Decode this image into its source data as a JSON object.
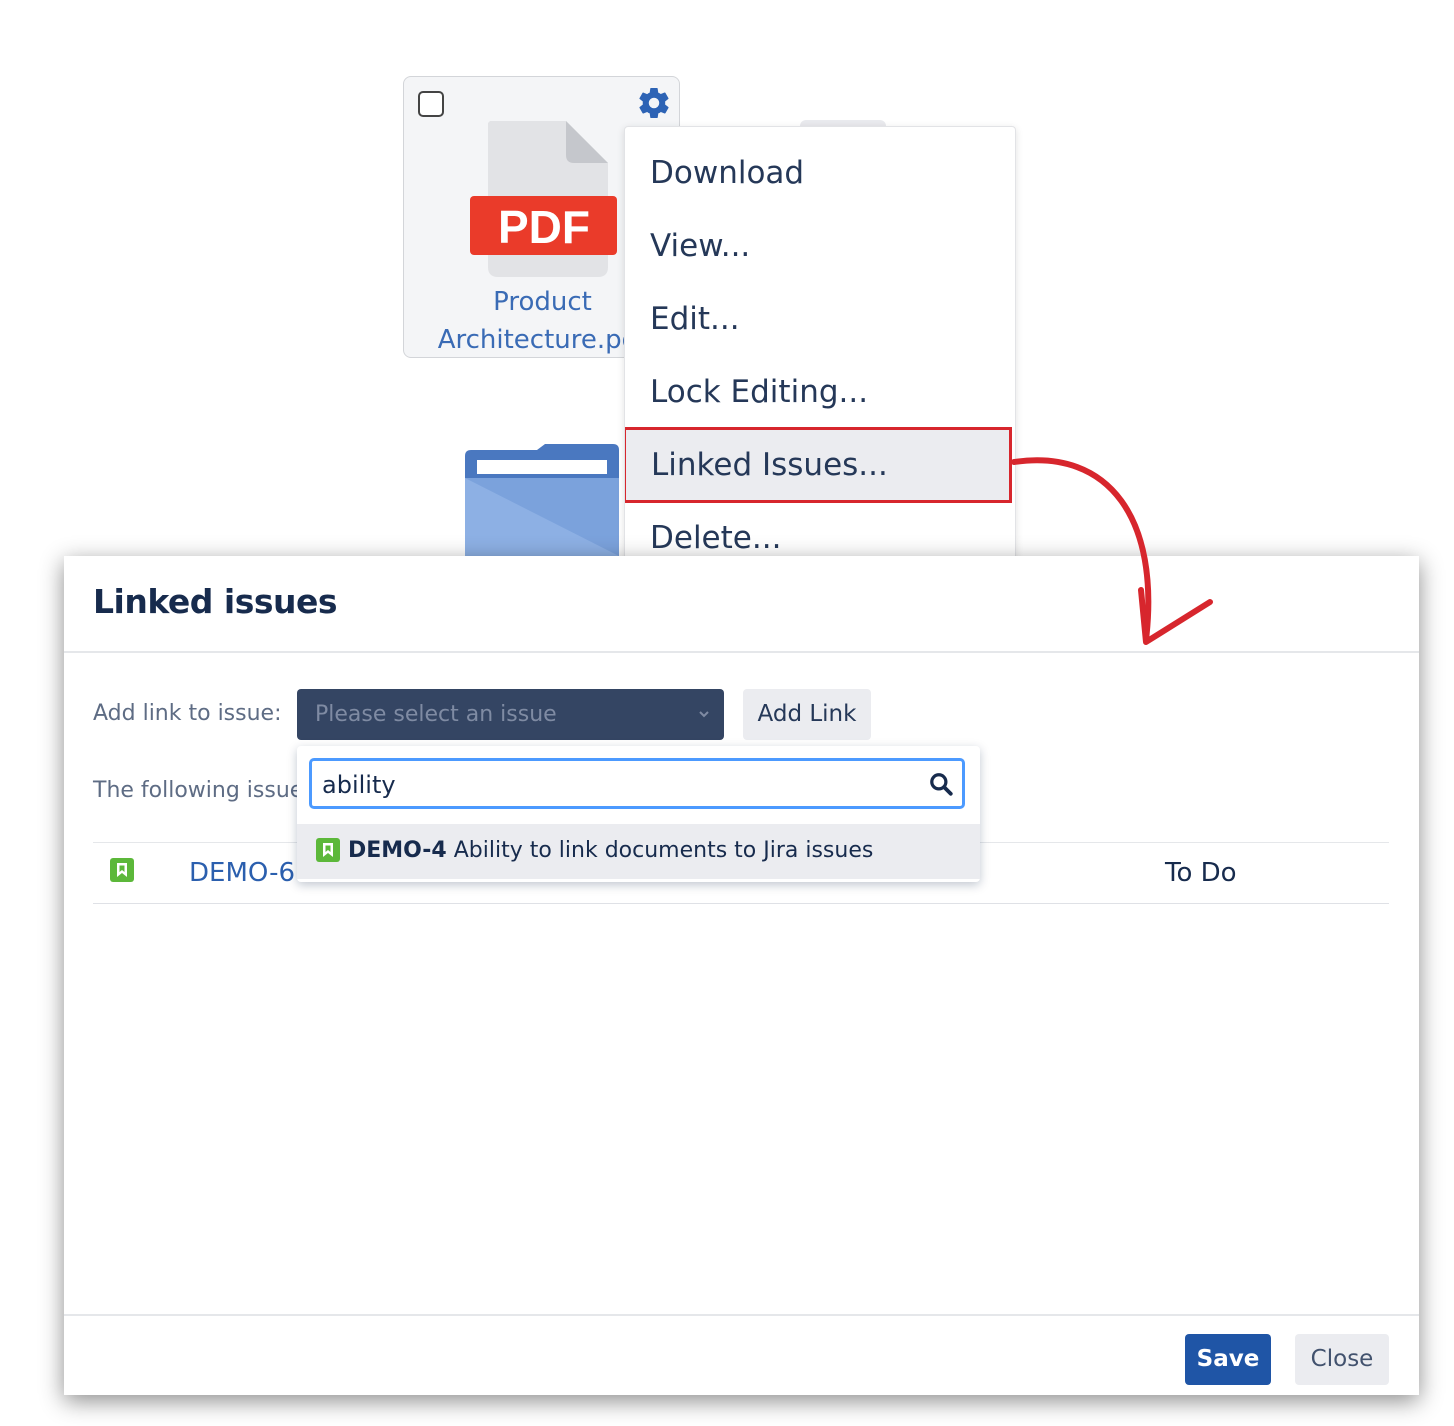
{
  "file_card": {
    "name_line1": "Product",
    "name_line2": "Architecture.pdf",
    "type_label": "PDF",
    "icons": [
      "checkbox",
      "gear-icon",
      "pdf-file-icon"
    ]
  },
  "folder": {
    "icon": "folder-icon"
  },
  "context_menu": {
    "items": [
      {
        "label": "Download"
      },
      {
        "label": "View..."
      },
      {
        "label": "Edit..."
      },
      {
        "label": "Lock Editing..."
      },
      {
        "label": "Linked Issues..."
      },
      {
        "label": "Delete..."
      }
    ],
    "highlighted": "Linked Issues..."
  },
  "dialog": {
    "title": "Linked issues",
    "add_link_label": "Add link to issue:",
    "select_placeholder": "Please select an issue",
    "add_link_button": "Add Link",
    "following_label": "The following issues",
    "search": {
      "value": "ability"
    },
    "result": {
      "key": "DEMO-4",
      "summary": "Ability to link documents to Jira issues"
    },
    "rows": [
      {
        "key": "DEMO-6",
        "status": "To Do"
      }
    ],
    "footer": {
      "save": "Save",
      "close": "Close"
    }
  },
  "colors": {
    "accent_red": "#d7262d",
    "primary_blue": "#1f55a6",
    "link_blue": "#2b5fae",
    "story_green": "#5cb83a",
    "select_bg": "#344563"
  }
}
